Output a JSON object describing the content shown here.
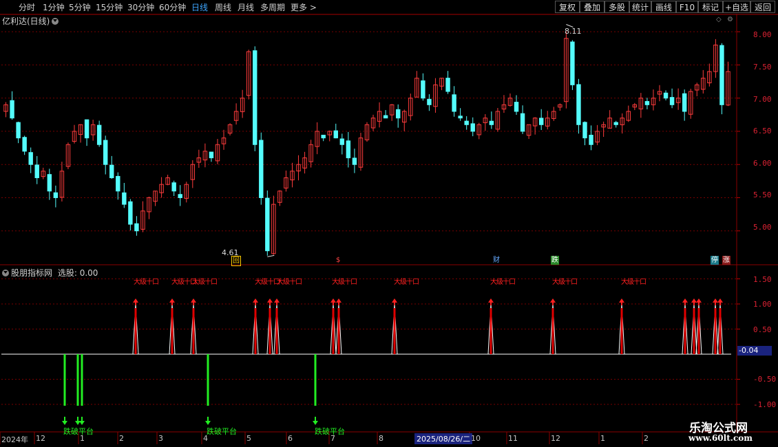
{
  "toolbar": {
    "periods": [
      "分时",
      "1分钟",
      "5分钟",
      "15分钟",
      "30分钟",
      "60分钟",
      "日线",
      "周线",
      "月线",
      "多周期",
      "更多 >"
    ],
    "active_period": "日线",
    "buttons": [
      "复权",
      "叠加",
      "多股",
      "统计",
      "画线",
      "F10",
      "标记",
      "+自选",
      "返回"
    ]
  },
  "main_panel": {
    "title": "亿利达(日线)",
    "high_label": "8.11",
    "low_label": "4.61",
    "y_ticks": [
      "8.00",
      "7.50",
      "7.00",
      "6.50",
      "6.00",
      "5.50",
      "5.00"
    ],
    "event_icons": [
      {
        "text": "回",
        "color": "#ffcc00"
      },
      {
        "text": "$",
        "color": "#ff4444"
      },
      {
        "text": "财",
        "color": "#66aaff"
      },
      {
        "text": "跌",
        "color": "#ffffff"
      },
      {
        "text": "停",
        "color": "#55ddff"
      },
      {
        "text": "涨",
        "color": "#ff5555"
      }
    ]
  },
  "indicator_panel": {
    "title": "股朋指标网",
    "xuangu_label": "选股: 0.00",
    "y_ticks": [
      "1.50",
      "1.00",
      "0.50",
      "-0.50",
      "-1.00"
    ],
    "current_value": "-0.04",
    "red_labels": [
      "大级十口",
      "大级十口",
      "大级十口",
      "大级十口",
      "大级十口",
      "大级十口",
      "大级十口",
      "大级十口",
      "大级十口",
      "大级十口"
    ],
    "green_labels": [
      "跌破平台",
      "跌破平台",
      "跌破平台"
    ]
  },
  "x_axis": {
    "labels": [
      "2024年",
      "12",
      "1",
      "2",
      "3",
      "4",
      "5",
      "6",
      "7",
      "8",
      "2025/08/26/二",
      "10",
      "11",
      "12",
      "1",
      "2"
    ]
  },
  "watermark": {
    "line1": "乐淘公式网",
    "line2": "www.60lt.com"
  },
  "chart_data": {
    "type": "candlestick",
    "title": "亿利达(日线)",
    "ylim": [
      4.5,
      8.25
    ],
    "y_ticks": [
      5.0,
      5.5,
      6.0,
      6.5,
      7.0,
      7.5,
      8.0
    ],
    "annotations": [
      {
        "text": "8.11",
        "value": 8.11
      },
      {
        "text": "4.61",
        "value": 4.61
      }
    ],
    "close_approx": [
      6.9,
      6.7,
      6.4,
      6.2,
      6.0,
      5.8,
      5.9,
      5.6,
      5.5,
      5.9,
      6.3,
      6.5,
      6.6,
      6.4,
      6.6,
      6.3,
      6.0,
      5.8,
      5.6,
      5.4,
      5.1,
      5.0,
      5.3,
      5.5,
      5.6,
      5.7,
      5.8,
      5.6,
      5.5,
      5.7,
      6.0,
      6.1,
      6.2,
      6.1,
      6.3,
      6.4,
      6.6,
      6.8,
      7.0,
      7.7,
      6.3,
      5.5,
      4.7,
      5.4,
      5.6,
      5.8,
      5.9,
      6.0,
      6.1,
      6.3,
      6.5,
      6.4,
      6.5,
      6.4,
      6.3,
      6.1,
      6.0,
      6.4,
      6.6,
      6.7,
      6.8,
      6.7,
      6.9,
      6.7,
      6.8,
      7.0,
      7.3,
      7.0,
      6.9,
      7.2,
      7.3,
      7.1,
      6.8,
      6.7,
      6.6,
      6.5,
      6.6,
      6.7,
      6.6,
      6.8,
      6.9,
      7.0,
      6.8,
      6.5,
      6.6,
      6.7,
      6.6,
      6.7,
      6.8,
      6.9,
      7.9,
      7.2,
      6.6,
      6.4,
      6.3,
      6.5,
      6.6,
      6.7,
      6.6,
      6.7,
      6.8,
      6.9,
      7.0,
      6.9,
      7.0,
      7.1,
      7.0,
      6.9,
      7.0,
      6.8,
      7.1,
      7.2,
      7.3,
      7.4,
      7.8,
      6.9,
      7.4
    ]
  }
}
